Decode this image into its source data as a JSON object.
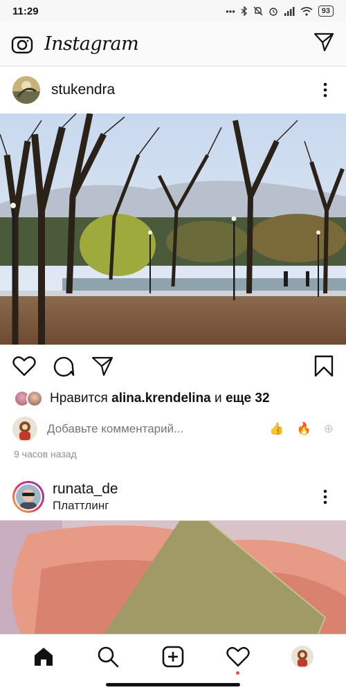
{
  "status_bar": {
    "time": "11:29",
    "dots": "•••",
    "battery": "93"
  },
  "header": {
    "title": "Instagram"
  },
  "posts": [
    {
      "username": "stukendra",
      "likes": {
        "prefix": "Нравится",
        "user": "alina.krendelina",
        "connector": "и",
        "more": "еще 32"
      },
      "comment_placeholder": "Добавьте комментарий...",
      "reactions": [
        "👍",
        "🔥",
        "⊕"
      ],
      "timestamp": "9 часов назад"
    },
    {
      "username": "runata_de",
      "location": "Платтлинг"
    }
  ],
  "nav": [
    "home-icon",
    "search-icon",
    "add-post-icon",
    "activity-icon",
    "profile-avatar"
  ],
  "colors": {
    "notification": "#ed4956",
    "text": "#262626",
    "muted": "#8e8e8e"
  }
}
